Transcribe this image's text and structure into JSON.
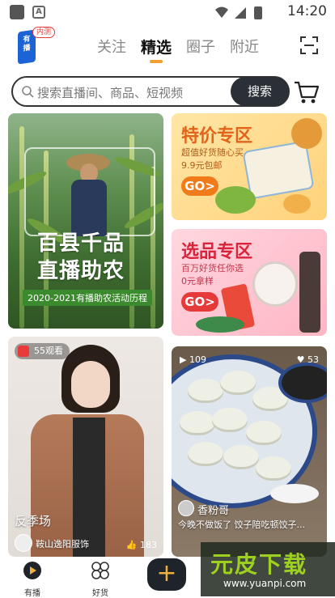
{
  "status_bar": {
    "time": "14:20",
    "a_icon_label": "A"
  },
  "header": {
    "logo_badge": "内测",
    "tabs": [
      {
        "label": "关注",
        "active": false
      },
      {
        "label": "精选",
        "active": true
      },
      {
        "label": "圈子",
        "active": false
      },
      {
        "label": "附近",
        "active": false
      }
    ]
  },
  "search": {
    "placeholder": "搜索直播间、商品、短视频",
    "button_label": "搜索"
  },
  "promo_main": {
    "title_line1": "百县千品",
    "title_line2": "直播助农",
    "subtitle": "2020-2021有播助农活动历程"
  },
  "promo_special": {
    "title": "特价专区",
    "subtitle": "超值好货随心买",
    "price": "9.9元包邮",
    "go_label": "GO>"
  },
  "promo_select": {
    "title": "选品专区",
    "subtitle": "百万好货任你选",
    "price": "0元拿样",
    "go_label": "GO>"
  },
  "live_card": {
    "viewers": "55观看",
    "title": "反季场",
    "shop": "鞍山逸阳服饰",
    "likes": "183"
  },
  "video_card": {
    "plays": "109",
    "likes": "53",
    "author": "香粉哥",
    "caption": "今晚不做饭了 饺子陪吃顿饺子..."
  },
  "bottom_nav": {
    "items": [
      {
        "label": "有播"
      },
      {
        "label": "好货"
      }
    ]
  },
  "watermark": {
    "logo": "元皮下载",
    "url": "www.yuanpi.com"
  },
  "colors": {
    "accent": "#f0a030",
    "dark": "#1f242b",
    "promo_orange": "#f07b1a",
    "promo_red": "#e63a3a"
  }
}
